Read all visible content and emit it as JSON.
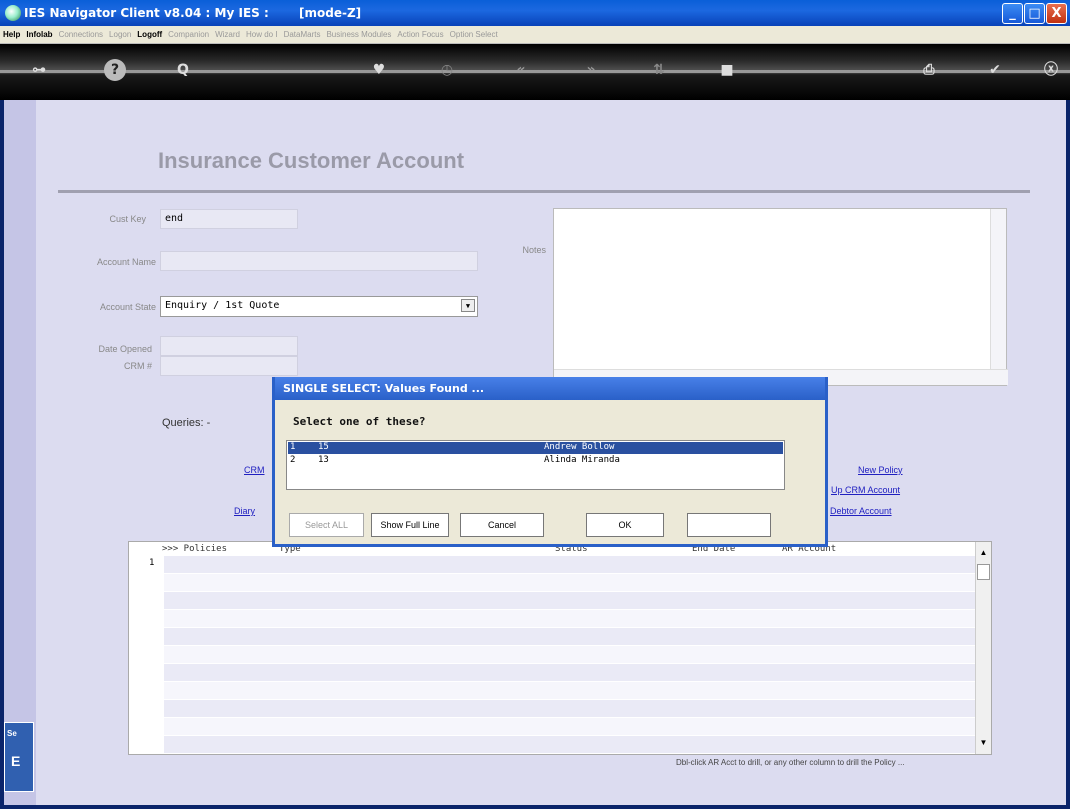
{
  "window": {
    "title": "IES Navigator Client v8.04 : My IES :",
    "mode": "[mode-Z]",
    "min": "_",
    "max": "□",
    "close": "X"
  },
  "menu": [
    {
      "label": "Help",
      "active": true
    },
    {
      "label": "Infolab",
      "active": true
    },
    {
      "label": "Connections",
      "active": false
    },
    {
      "label": "Logon",
      "active": false
    },
    {
      "label": "Logoff",
      "active": true
    },
    {
      "label": "Companion",
      "active": false
    },
    {
      "label": "Wizard",
      "active": false
    },
    {
      "label": "How do I",
      "active": false
    },
    {
      "label": "DataMarts",
      "active": false
    },
    {
      "label": "Business Modules",
      "active": false
    },
    {
      "label": "Action Focus",
      "active": false
    },
    {
      "label": "Option Select",
      "active": false
    }
  ],
  "toolbar": {
    "key": "⊶",
    "help": "?",
    "search": "Q",
    "fav": "♥",
    "clock": "◷",
    "prev": "«",
    "next": "»",
    "sort": "⇅",
    "stop": "■",
    "print": "⎙",
    "ok": "✔",
    "close": "ⓧ"
  },
  "form": {
    "header": "Insurance Customer Account",
    "cust_key_label": "Cust Key",
    "cust_key": "end",
    "account_name_label": "Account Name",
    "account_name": "",
    "account_state_label": "Account State",
    "account_state": "Enquiry / 1st Quote",
    "date_opened_label": "Date Opened",
    "date_opened": "",
    "crm_label": "CRM #",
    "crm": "",
    "notes_label": "Notes",
    "queries_label": "Queries: -",
    "links_left": [
      "CRM",
      "Diary"
    ],
    "links_right": [
      "New Policy",
      "Up CRM Account",
      "Debtor Account"
    ]
  },
  "grid": {
    "columns": [
      ">>> Policies",
      "Type",
      "Status",
      "End Date",
      "AR Account"
    ],
    "row_number": "1",
    "hint": "Dbl-click AR Acct to drill, or any other column  to drill the Policy ..."
  },
  "side": {
    "label": "Se",
    "glyph": "E"
  },
  "dialog": {
    "title": "SINGLE SELECT: Values Found ...",
    "question": "Select one of these?",
    "items": [
      {
        "idx": "1",
        "code": "15",
        "name": "Andrew Bollow",
        "selected": true
      },
      {
        "idx": "2",
        "code": "13",
        "name": "Alinda Miranda",
        "selected": false
      }
    ],
    "buttons": {
      "select_all": "Select ALL",
      "show_full": "Show Full Line",
      "cancel": "Cancel",
      "ok": "OK"
    },
    "filter": ""
  }
}
